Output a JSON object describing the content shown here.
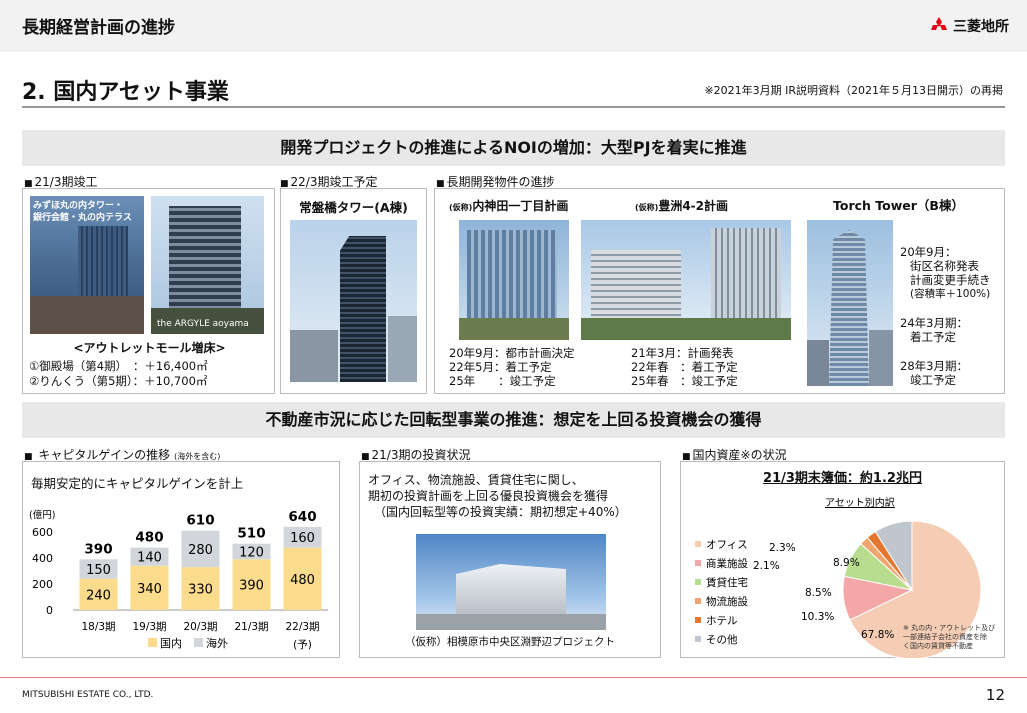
{
  "header": {
    "title": "長期経営計画の進捗",
    "logo_text": "三菱地所"
  },
  "section": {
    "title": "2. 国内アセット事業",
    "note": "※2021年3月期 IR説明資料（2021年５月13日開示）の再掲"
  },
  "band1": "開発プロジェクトの推進によるNOIの増加：大型PJを着実に推進",
  "completed": {
    "label": "21/3期竣工",
    "photo1_caption": [
      "みずほ丸の内タワー・",
      "銀行会館・丸の内テラス"
    ],
    "photo2_caption": "the ARGYLE aoyama",
    "outlet_title": "<アウトレットモール増床>",
    "outlet_lines": [
      "①御殿場（第4期）　：＋16,400㎡",
      "②りんくう（第5期）：＋10,700㎡"
    ]
  },
  "planned": {
    "label": "22/3期竣工予定",
    "name": "常盤橋タワー(A棟)"
  },
  "long_term": {
    "label": "長期開発物件の進捗",
    "p1": {
      "prefix": "(仮称)",
      "name": "内神田一丁目計画",
      "lines": [
        "20年9月：都市計画決定",
        "22年5月：着工予定",
        "25年　　：竣工予定"
      ]
    },
    "p2": {
      "prefix": "(仮称)",
      "name": "豊洲4-2計画",
      "lines": [
        "21年3月：計画発表",
        "22年春　：着工予定",
        "25年春　：竣工予定"
      ]
    },
    "p3": {
      "name": "Torch Tower（B棟）",
      "lines": [
        "20年9月：",
        "街区名称発表",
        "計画変更手続き",
        "(容積率＋100%)",
        "24年3月期：",
        "着工予定",
        "28年3月期：",
        "竣工予定"
      ]
    }
  },
  "band2": "不動産市況に応じた回転型事業の推進：想定を上回る投資機会の獲得",
  "capital_gain": {
    "label": "キャピタルゲインの推移",
    "label_small": "(海外を含む)",
    "subtitle": "毎期安定的にキャピタルゲインを計上"
  },
  "investment": {
    "label": "21/3期の投資状況",
    "lines": [
      "オフィス、物流施設、賃貸住宅に関し、",
      "期初の投資計画を上回る優良投資機会を獲得",
      "（国内回転型等の投資実績：期初想定+40%）"
    ],
    "caption": "（仮称）相模原市中央区淵野辺プロジェクト"
  },
  "domestic": {
    "label": "国内資産※の状況",
    "headline": "21/3期末簿価：約1.2兆円",
    "footnote": [
      "※ 丸の内・アウトレット及び",
      "一部連結子会社の資産を除",
      "く国内の賃貸等不動産"
    ]
  },
  "chart_data": [
    {
      "type": "bar",
      "stacked": true,
      "ylabel": "(億円)",
      "ylim": [
        0,
        600
      ],
      "yticks": [
        0,
        200,
        400,
        600
      ],
      "categories": [
        "18/3期",
        "19/3期",
        "20/3期",
        "21/3期",
        "22/3期"
      ],
      "category_sub": [
        "",
        "",
        "",
        "",
        "(予)"
      ],
      "series": [
        {
          "name": "国内",
          "values": [
            240,
            340,
            330,
            390,
            480
          ],
          "color": "#fbdc8c"
        },
        {
          "name": "海外",
          "values": [
            150,
            140,
            280,
            120,
            160
          ],
          "color": "#d2d6db"
        }
      ],
      "totals": [
        390,
        480,
        610,
        510,
        640
      ]
    },
    {
      "type": "pie",
      "title": "アセット別内訳",
      "slices": [
        {
          "name": "オフィス",
          "value": 67.8,
          "label": "67.8%",
          "color": "#f5cdb4"
        },
        {
          "name": "商業施設",
          "value": 10.3,
          "label": "10.3%",
          "color": "#f3a7a7"
        },
        {
          "name": "賃貸住宅",
          "value": 8.5,
          "label": "8.5%",
          "color": "#b9dd8f"
        },
        {
          "name": "物流施設",
          "value": 2.1,
          "label": "2.1%",
          "color": "#f0a671"
        },
        {
          "name": "ホテル",
          "value": 2.3,
          "label": "2.3%",
          "color": "#e5762f"
        },
        {
          "name": "その他",
          "value": 8.9,
          "label": "8.9%",
          "color": "#bfc6cd"
        }
      ]
    }
  ],
  "footer": {
    "company": "MITSUBISHI ESTATE CO., LTD.",
    "page": "12"
  }
}
